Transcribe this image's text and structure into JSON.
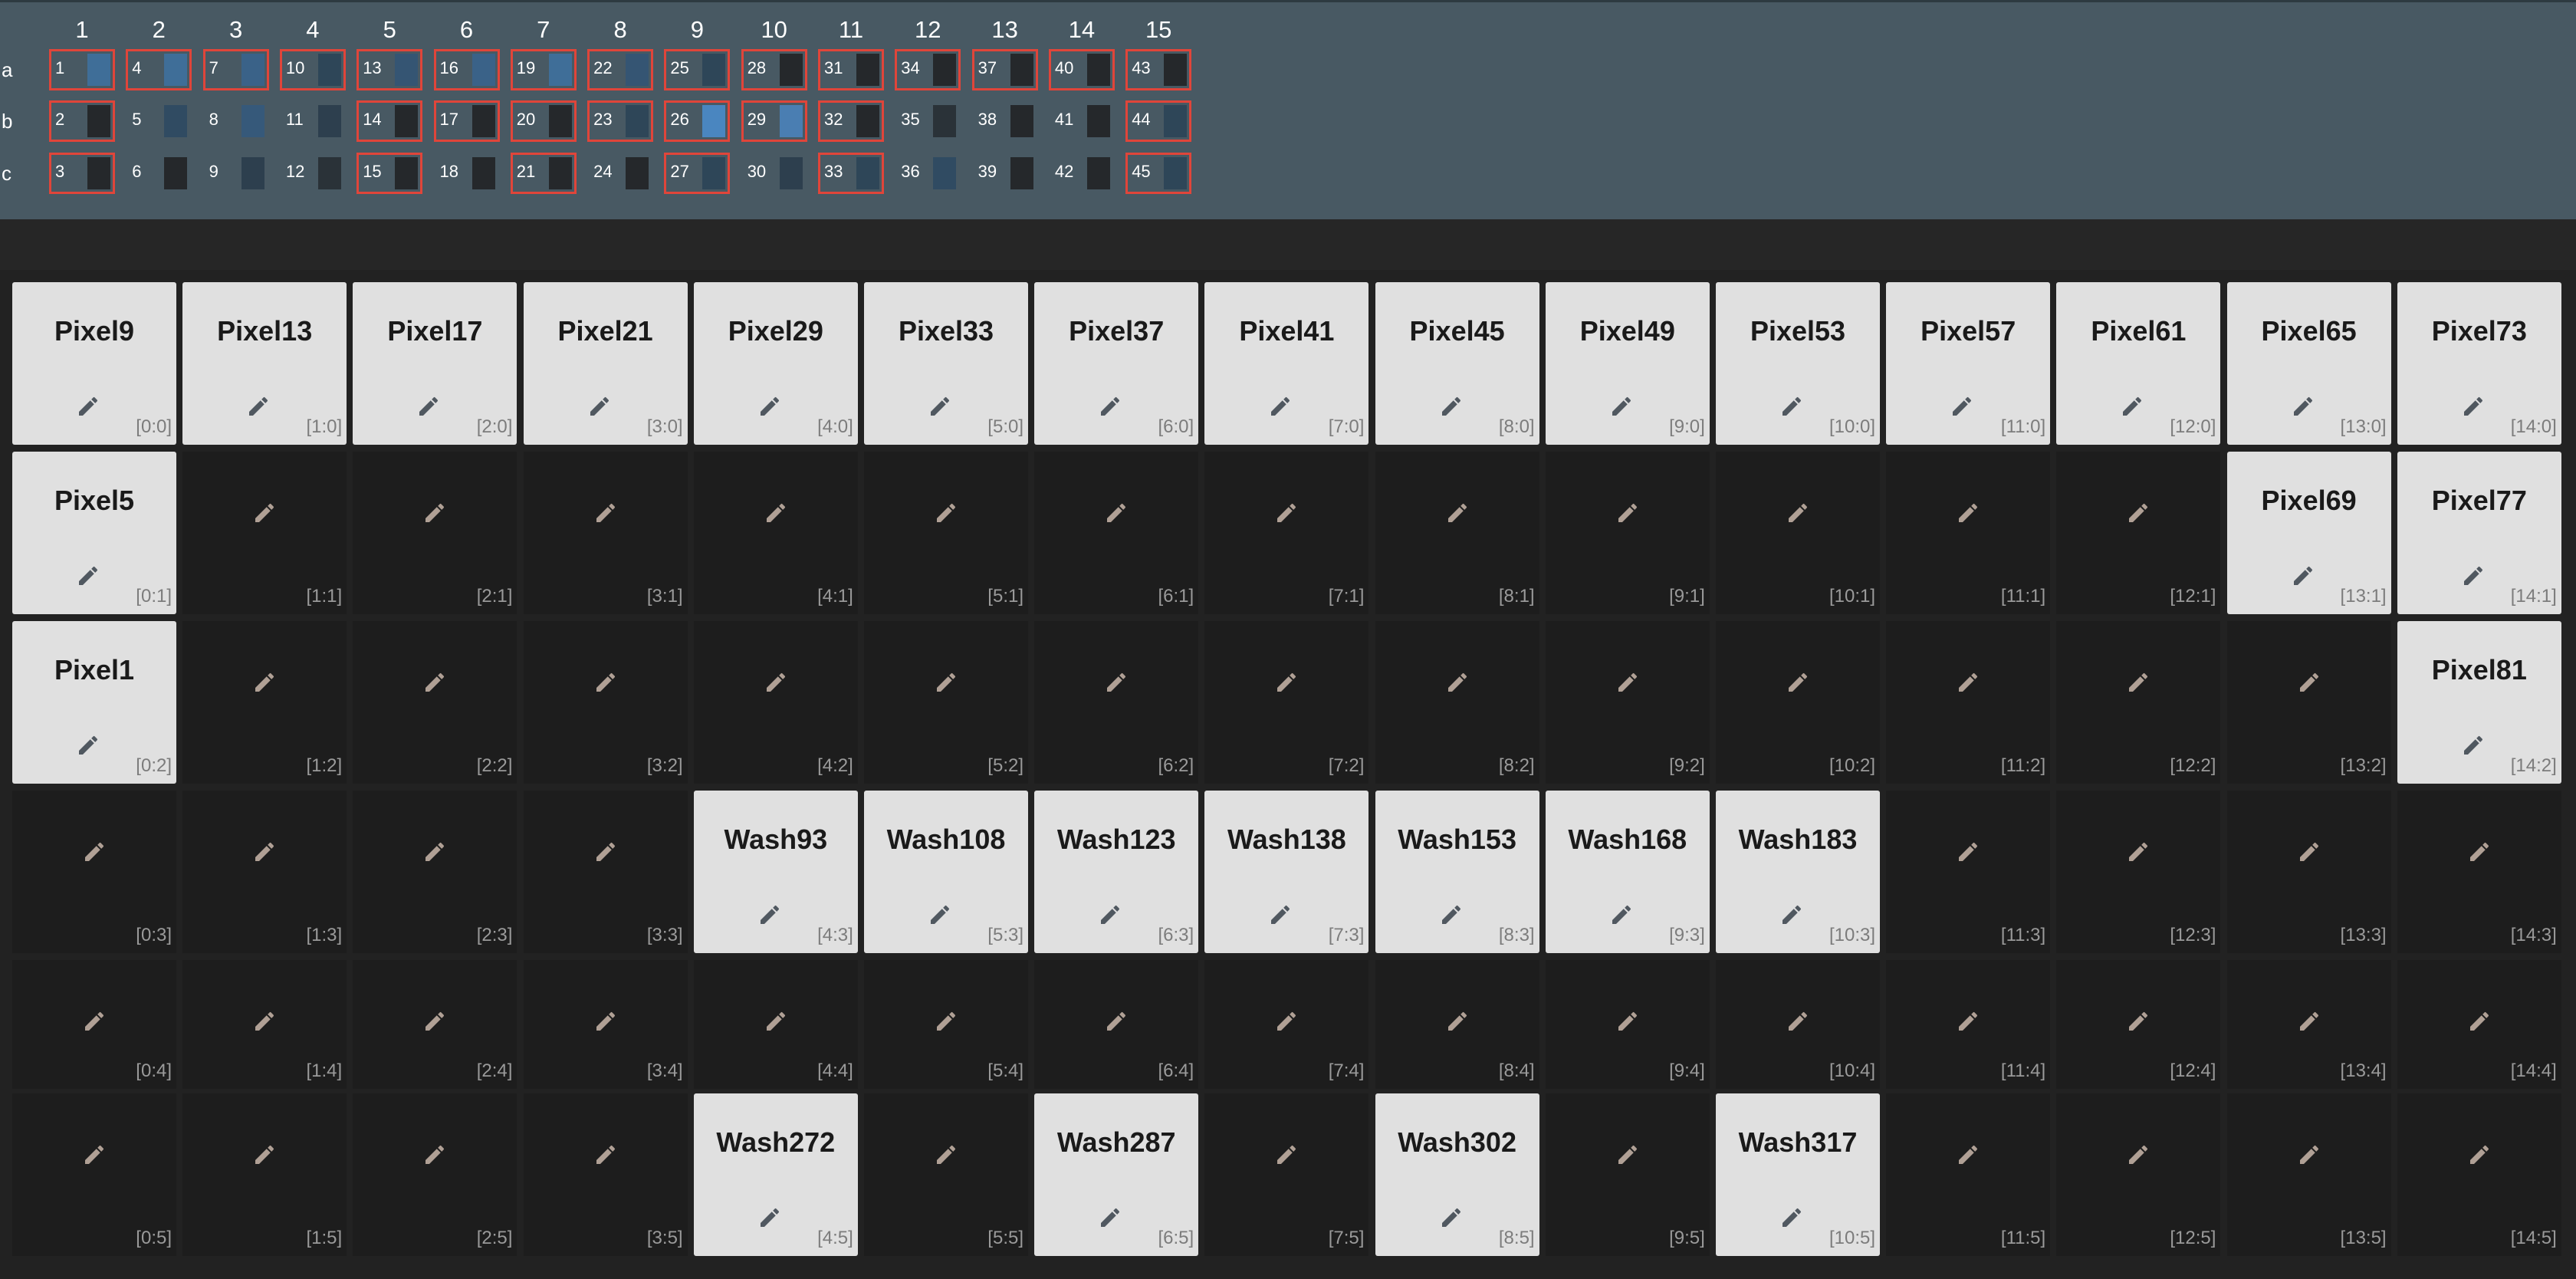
{
  "patch": {
    "columns": [
      "1",
      "2",
      "3",
      "4",
      "5",
      "6",
      "7",
      "8",
      "9",
      "10",
      "11",
      "12",
      "13",
      "14",
      "15"
    ],
    "rows": [
      {
        "label": "a",
        "slots": [
          {
            "num": "1",
            "selected": true,
            "color": "#3f6e98"
          },
          {
            "num": "4",
            "selected": true,
            "color": "#3f6e98"
          },
          {
            "num": "7",
            "selected": true,
            "color": "#3a6288"
          },
          {
            "num": "10",
            "selected": true,
            "color": "#2e4658"
          },
          {
            "num": "13",
            "selected": true,
            "color": "#355573"
          },
          {
            "num": "16",
            "selected": true,
            "color": "#3a6288"
          },
          {
            "num": "19",
            "selected": true,
            "color": "#3f6e98"
          },
          {
            "num": "22",
            "selected": true,
            "color": "#355573"
          },
          {
            "num": "25",
            "selected": true,
            "color": "#2e4658"
          },
          {
            "num": "28",
            "selected": true,
            "color": "#25282b"
          },
          {
            "num": "31",
            "selected": true,
            "color": "#25282b"
          },
          {
            "num": "34",
            "selected": true,
            "color": "#25282b"
          },
          {
            "num": "37",
            "selected": true,
            "color": "#25282b"
          },
          {
            "num": "40",
            "selected": true,
            "color": "#25282b"
          },
          {
            "num": "43",
            "selected": true,
            "color": "#25282b"
          }
        ]
      },
      {
        "label": "b",
        "slots": [
          {
            "num": "2",
            "selected": true,
            "color": "#25282b"
          },
          {
            "num": "5",
            "selected": false,
            "color": "#304b62"
          },
          {
            "num": "8",
            "selected": false,
            "color": "#36597a"
          },
          {
            "num": "11",
            "selected": false,
            "color": "#2d3f4e"
          },
          {
            "num": "14",
            "selected": true,
            "color": "#25282b"
          },
          {
            "num": "17",
            "selected": true,
            "color": "#25282b"
          },
          {
            "num": "20",
            "selected": true,
            "color": "#25282b"
          },
          {
            "num": "23",
            "selected": true,
            "color": "#2e4658"
          },
          {
            "num": "26",
            "selected": true,
            "color": "#4a86c0"
          },
          {
            "num": "29",
            "selected": true,
            "color": "#4a7eb2"
          },
          {
            "num": "32",
            "selected": true,
            "color": "#25282b"
          },
          {
            "num": "35",
            "selected": false,
            "color": "#2a3238"
          },
          {
            "num": "38",
            "selected": false,
            "color": "#25282b"
          },
          {
            "num": "41",
            "selected": false,
            "color": "#25282b"
          },
          {
            "num": "44",
            "selected": true,
            "color": "#2e4658"
          }
        ]
      },
      {
        "label": "c",
        "slots": [
          {
            "num": "3",
            "selected": true,
            "color": "#25282b"
          },
          {
            "num": "6",
            "selected": false,
            "color": "#25282b"
          },
          {
            "num": "9",
            "selected": false,
            "color": "#2d3f4e"
          },
          {
            "num": "12",
            "selected": false,
            "color": "#2a3238"
          },
          {
            "num": "15",
            "selected": true,
            "color": "#25282b"
          },
          {
            "num": "18",
            "selected": false,
            "color": "#25282b"
          },
          {
            "num": "21",
            "selected": true,
            "color": "#25282b"
          },
          {
            "num": "24",
            "selected": false,
            "color": "#25282b"
          },
          {
            "num": "27",
            "selected": true,
            "color": "#2e4658"
          },
          {
            "num": "30",
            "selected": false,
            "color": "#2d3f4e"
          },
          {
            "num": "33",
            "selected": true,
            "color": "#2e4658"
          },
          {
            "num": "36",
            "selected": false,
            "color": "#304b62"
          },
          {
            "num": "39",
            "selected": false,
            "color": "#25282b"
          },
          {
            "num": "42",
            "selected": false,
            "color": "#25282b"
          },
          {
            "num": "45",
            "selected": true,
            "color": "#2e4658"
          }
        ]
      }
    ]
  },
  "grid": {
    "rows": [
      [
        "Pixel9",
        "Pixel13",
        "Pixel17",
        "Pixel21",
        "Pixel29",
        "Pixel33",
        "Pixel37",
        "Pixel41",
        "Pixel45",
        "Pixel49",
        "Pixel53",
        "Pixel57",
        "Pixel61",
        "Pixel65",
        "Pixel73"
      ],
      [
        "Pixel5",
        "",
        "",
        "",
        "",
        "",
        "",
        "",
        "",
        "",
        "",
        "",
        "",
        "Pixel69",
        "Pixel77"
      ],
      [
        "Pixel1",
        "",
        "",
        "",
        "",
        "",
        "",
        "",
        "",
        "",
        "",
        "",
        "",
        "",
        "Pixel81"
      ],
      [
        "",
        "",
        "",
        "",
        "Wash93",
        "Wash108",
        "Wash123",
        "Wash138",
        "Wash153",
        "Wash168",
        "Wash183",
        "",
        "",
        "",
        ""
      ],
      [
        "",
        "",
        "",
        "",
        "",
        "",
        "",
        "",
        "",
        "",
        "",
        "",
        "",
        "",
        ""
      ],
      [
        "",
        "",
        "",
        "",
        "Wash272",
        "",
        "Wash287",
        "",
        "Wash302",
        "",
        "Wash317",
        "",
        "",
        "",
        ""
      ]
    ],
    "coords": [
      [
        "[0:0]",
        "[1:0]",
        "[2:0]",
        "[3:0]",
        "[4:0]",
        "[5:0]",
        "[6:0]",
        "[7:0]",
        "[8:0]",
        "[9:0]",
        "[10:0]",
        "[11:0]",
        "[12:0]",
        "[13:0]",
        "[14:0]"
      ],
      [
        "[0:1]",
        "[1:1]",
        "[2:1]",
        "[3:1]",
        "[4:1]",
        "[5:1]",
        "[6:1]",
        "[7:1]",
        "[8:1]",
        "[9:1]",
        "[10:1]",
        "[11:1]",
        "[12:1]",
        "[13:1]",
        "[14:1]"
      ],
      [
        "[0:2]",
        "[1:2]",
        "[2:2]",
        "[3:2]",
        "[4:2]",
        "[5:2]",
        "[6:2]",
        "[7:2]",
        "[8:2]",
        "[9:2]",
        "[10:2]",
        "[11:2]",
        "[12:2]",
        "[13:2]",
        "[14:2]"
      ],
      [
        "[0:3]",
        "[1:3]",
        "[2:3]",
        "[3:3]",
        "[4:3]",
        "[5:3]",
        "[6:3]",
        "[7:3]",
        "[8:3]",
        "[9:3]",
        "[10:3]",
        "[11:3]",
        "[12:3]",
        "[13:3]",
        "[14:3]"
      ],
      [
        "[0:4]",
        "[1:4]",
        "[2:4]",
        "[3:4]",
        "[4:4]",
        "[5:4]",
        "[6:4]",
        "[7:4]",
        "[8:4]",
        "[9:4]",
        "[10:4]",
        "[11:4]",
        "[12:4]",
        "[13:4]",
        "[14:4]"
      ],
      [
        "[0:5]",
        "[1:5]",
        "[2:5]",
        "[3:5]",
        "[4:5]",
        "[5:5]",
        "[6:5]",
        "[7:5]",
        "[8:5]",
        "[9:5]",
        "[10:5]",
        "[11:5]",
        "[12:5]",
        "[13:5]",
        "[14:5]"
      ]
    ],
    "icon": "pencil-icon",
    "colors": {
      "assigned_bg": "#e0e0e0",
      "empty_bg": "#1d1d1d",
      "pencil_on_assigned": "#505860",
      "pencil_on_empty": "#b0a095",
      "selected_border": "#e0453a"
    }
  }
}
